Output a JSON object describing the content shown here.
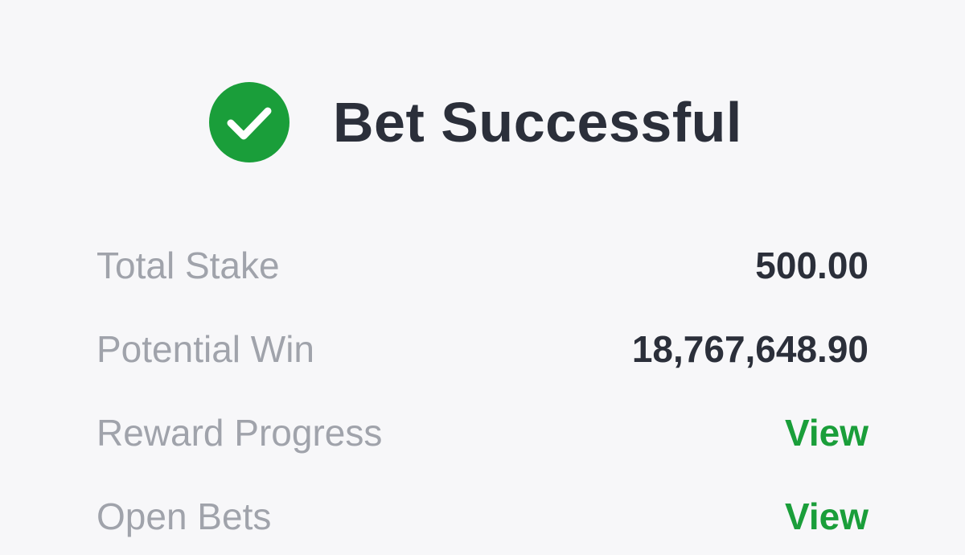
{
  "header": {
    "title": "Bet Successful",
    "icon": "check-circle-icon",
    "icon_color": "#1a9e3a"
  },
  "summary": {
    "total_stake": {
      "label": "Total Stake",
      "value": "500.00"
    },
    "potential_win": {
      "label": "Potential Win",
      "value": "18,767,648.90"
    },
    "reward_progress": {
      "label": "Reward Progress",
      "action": "View"
    },
    "open_bets": {
      "label": "Open Bets",
      "action": "View"
    }
  },
  "colors": {
    "accent": "#1a9e3a",
    "text_primary": "#2b2f3a",
    "text_secondary": "#a0a3ab",
    "background": "#f7f7f9"
  }
}
